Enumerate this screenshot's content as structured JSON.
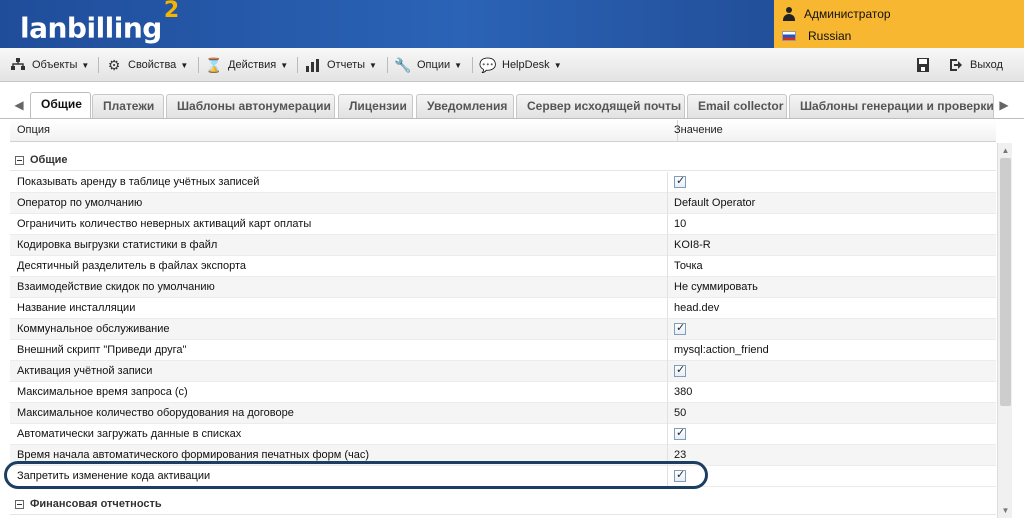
{
  "app": {
    "logo": "lanbilling",
    "logo_version": "2"
  },
  "user_panel": {
    "user": "Администратор",
    "language": "Russian"
  },
  "menu": {
    "items": [
      {
        "label": "Объекты",
        "icon": "tree-icon"
      },
      {
        "label": "Свойства",
        "icon": "gear-icon"
      },
      {
        "label": "Действия",
        "icon": "hourglass-icon"
      },
      {
        "label": "Отчеты",
        "icon": "bar-chart-icon"
      },
      {
        "label": "Опции",
        "icon": "wrench-icon"
      },
      {
        "label": "HelpDesk",
        "icon": "speech-bubble-icon"
      }
    ],
    "right": {
      "save_icon": "save-icon",
      "logout_label": "Выход",
      "logout_icon": "logout-icon"
    }
  },
  "tabs": [
    {
      "label": "Общие",
      "active": true
    },
    {
      "label": "Платежи",
      "active": false
    },
    {
      "label": "Шаблоны автонумерации",
      "active": false
    },
    {
      "label": "Лицензии",
      "active": false
    },
    {
      "label": "Уведомления",
      "active": false
    },
    {
      "label": "Сервер исходящей почты",
      "active": false
    },
    {
      "label": "Email collector",
      "active": false
    },
    {
      "label": "Шаблоны генерации и проверки п",
      "active": false
    }
  ],
  "grid": {
    "columns": {
      "option": "Опция",
      "value": "Значение"
    },
    "groups": [
      {
        "title": "Общие"
      },
      {
        "title": "Финансовая отчетность"
      }
    ],
    "rows": [
      {
        "option": "Показывать аренду в таблице учётных записей",
        "value": "",
        "checked": true
      },
      {
        "option": "Оператор по умолчанию",
        "value": "Default Operator",
        "checked": false
      },
      {
        "option": "Ограничить количество неверных активаций карт оплаты",
        "value": "10",
        "checked": false
      },
      {
        "option": "Кодировка выгрузки статистики в файл",
        "value": "KOI8-R",
        "checked": false
      },
      {
        "option": "Десятичный разделитель в файлах экспорта",
        "value": "Точка",
        "checked": false
      },
      {
        "option": "Взаимодействие скидок по умолчанию",
        "value": "Не суммировать",
        "checked": false
      },
      {
        "option": "Название инсталляции",
        "value": "head.dev",
        "checked": false
      },
      {
        "option": "Коммунальное обслуживание",
        "value": "",
        "checked": true
      },
      {
        "option": "Внешний скрипт \"Приведи друга\"",
        "value": "mysql:action_friend",
        "checked": false
      },
      {
        "option": "Активация учётной записи",
        "value": "",
        "checked": true
      },
      {
        "option": "Максимальное время запроса (с)",
        "value": "380",
        "checked": false
      },
      {
        "option": "Максимальное количество оборудования на договоре",
        "value": "50",
        "checked": false
      },
      {
        "option": "Автоматически загружать данные в списках",
        "value": "",
        "checked": true
      },
      {
        "option": "Время начала автоматического формирования печатных форм (час)",
        "value": "23",
        "checked": false
      },
      {
        "option": "Запретить изменение кода активации",
        "value": "",
        "checked": true
      }
    ]
  }
}
